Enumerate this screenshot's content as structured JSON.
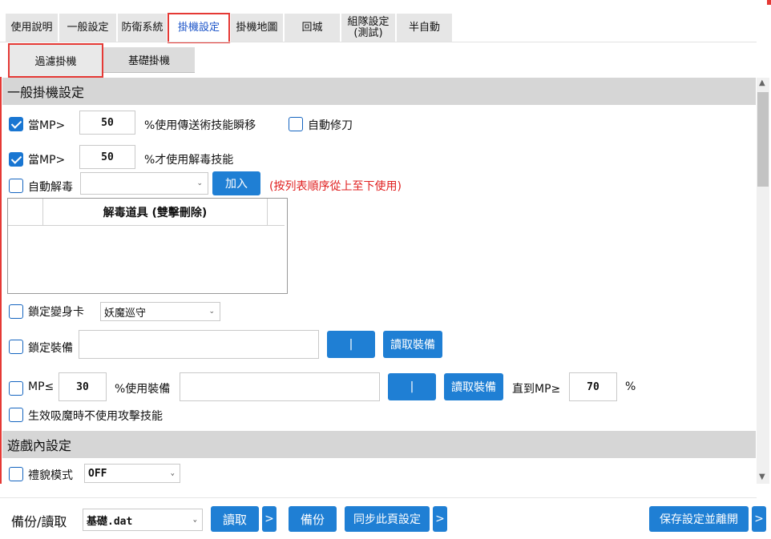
{
  "tabs": [
    {
      "label": "使用說明"
    },
    {
      "label": "一般設定"
    },
    {
      "label": "防衛系統"
    },
    {
      "label": "掛機設定"
    },
    {
      "label": "掛機地圖"
    },
    {
      "label": "回城"
    },
    {
      "label": "組隊設定\n(測試)"
    },
    {
      "label": "半自動"
    }
  ],
  "subtabs": [
    {
      "label": "過濾掛機"
    },
    {
      "label": "基礎掛機"
    }
  ],
  "sections": {
    "general": "一般掛機設定",
    "ingame": "遊戲內設定"
  },
  "rows": {
    "mp_teleport": {
      "prefix": "當MP>",
      "value": "50",
      "suffix": "%使用傳送術技能瞬移",
      "checked": true
    },
    "auto_repair": {
      "label": "自動修刀",
      "checked": false
    },
    "mp_cure": {
      "prefix": "當MP>",
      "value": "50",
      "suffix": "%才使用解毒技能",
      "checked": true
    },
    "auto_cure": {
      "label": "自動解毒",
      "select_value": "",
      "add_button": "加入",
      "hint": "(按列表順序從上至下使用)",
      "checked": false
    },
    "cure_table": {
      "header": "解毒道具 (雙擊刪除)"
    },
    "lock_poly": {
      "label": "鎖定變身卡",
      "select_value": "妖魔巡守",
      "checked": false
    },
    "lock_equip": {
      "label": "鎖定裝備",
      "btn_bar": "|",
      "btn_read": "讀取裝備",
      "checked": false
    },
    "mp_equip": {
      "prefix": "MP≤",
      "value": "30",
      "mid": "%使用裝備",
      "btn_bar": "|",
      "btn_read": "讀取裝備",
      "until": "直到MP≥",
      "until_value": "70",
      "unit": "%",
      "checked": false
    },
    "no_attack": {
      "label": "生效吸魔時不使用攻擊技能",
      "checked": false
    },
    "courtesy": {
      "label": "禮貌模式",
      "select_value": "OFF",
      "checked": false
    }
  },
  "footer": {
    "label": "備份/讀取",
    "file": "基礎.dat",
    "read": "讀取",
    "arrow": ">",
    "backup": "備份",
    "sync": "同步此頁設定",
    "save": "保存設定並離開"
  },
  "colors": {
    "accent": "#1f7fd4",
    "highlight": "#e53935",
    "hint": "#e02020",
    "active_tab_text": "#1a53c8"
  }
}
